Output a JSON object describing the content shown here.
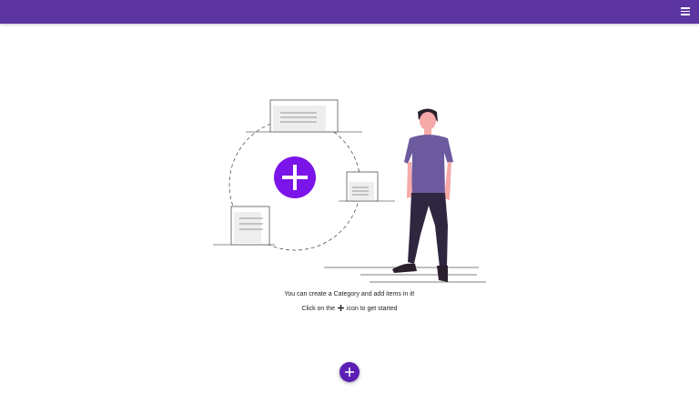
{
  "appbar": {
    "color": "#5c35a3",
    "menu_icon": "hamburger-menu-icon"
  },
  "empty_state": {
    "line1": "You can create a Category and add items in it!",
    "line2_prefix": "Click on the",
    "line2_icon": "plus-icon",
    "line2_suffix": "icon to get started",
    "illustration_accent": "#7b14e8",
    "person_shirt": "#6c5a9e",
    "person_pants": "#2f2640"
  },
  "fab": {
    "icon": "plus-icon",
    "color": "#5c1fb5"
  }
}
